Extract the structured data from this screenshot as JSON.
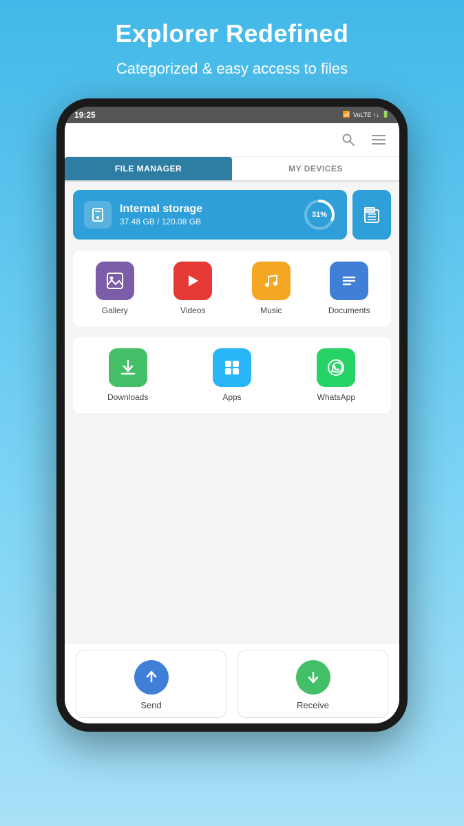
{
  "header": {
    "title": "Explorer Redefined",
    "subtitle": "Categorized & easy access to files"
  },
  "status_bar": {
    "time": "19:25",
    "signal": "VoLTE",
    "icons": "▲↓"
  },
  "tabs": [
    {
      "id": "file-manager",
      "label": "FILE MANAGER",
      "active": true
    },
    {
      "id": "my-devices",
      "label": "MY DEVICES",
      "active": false
    }
  ],
  "storage": {
    "internal": {
      "name": "Internal storage",
      "used": "37.48 GB",
      "total": "120.08 GB",
      "display": "37.48 GB / 120.08 GB",
      "percent": 31,
      "percent_label": "31%"
    }
  },
  "categories_row1": [
    {
      "id": "gallery",
      "label": "Gallery",
      "color": "#7b5ea7",
      "icon": "🖼"
    },
    {
      "id": "videos",
      "label": "Videos",
      "color": "#e53935",
      "icon": "▶"
    },
    {
      "id": "music",
      "label": "Music",
      "color": "#f5a623",
      "icon": "♪"
    },
    {
      "id": "documents",
      "label": "Documents",
      "color": "#3f7fd8",
      "icon": "≡"
    }
  ],
  "categories_row2": [
    {
      "id": "downloads",
      "label": "Downloads",
      "color": "#43c067",
      "icon": "↓"
    },
    {
      "id": "apps",
      "label": "Apps",
      "color": "#29b6f6",
      "icon": "⊞"
    },
    {
      "id": "whatsapp",
      "label": "WhatsApp",
      "color": "#25d366",
      "icon": "💬"
    }
  ],
  "actions": [
    {
      "id": "send",
      "label": "Send",
      "color": "#3f7fd8",
      "icon": "↑"
    },
    {
      "id": "receive",
      "label": "Receive",
      "color": "#43c067",
      "icon": "↓"
    }
  ]
}
